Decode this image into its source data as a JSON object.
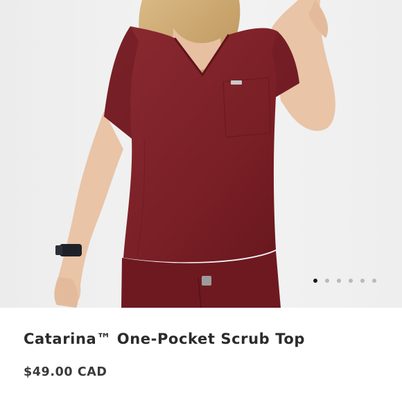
{
  "product": {
    "image_alt": "Woman wearing burgundy one-pocket scrub top",
    "title": "Catarina™ One-Pocket Scrub Top",
    "price": "$49.00 CAD",
    "color": "#7a1f26"
  },
  "gallery": {
    "total_images": 6,
    "active_index": 0
  }
}
